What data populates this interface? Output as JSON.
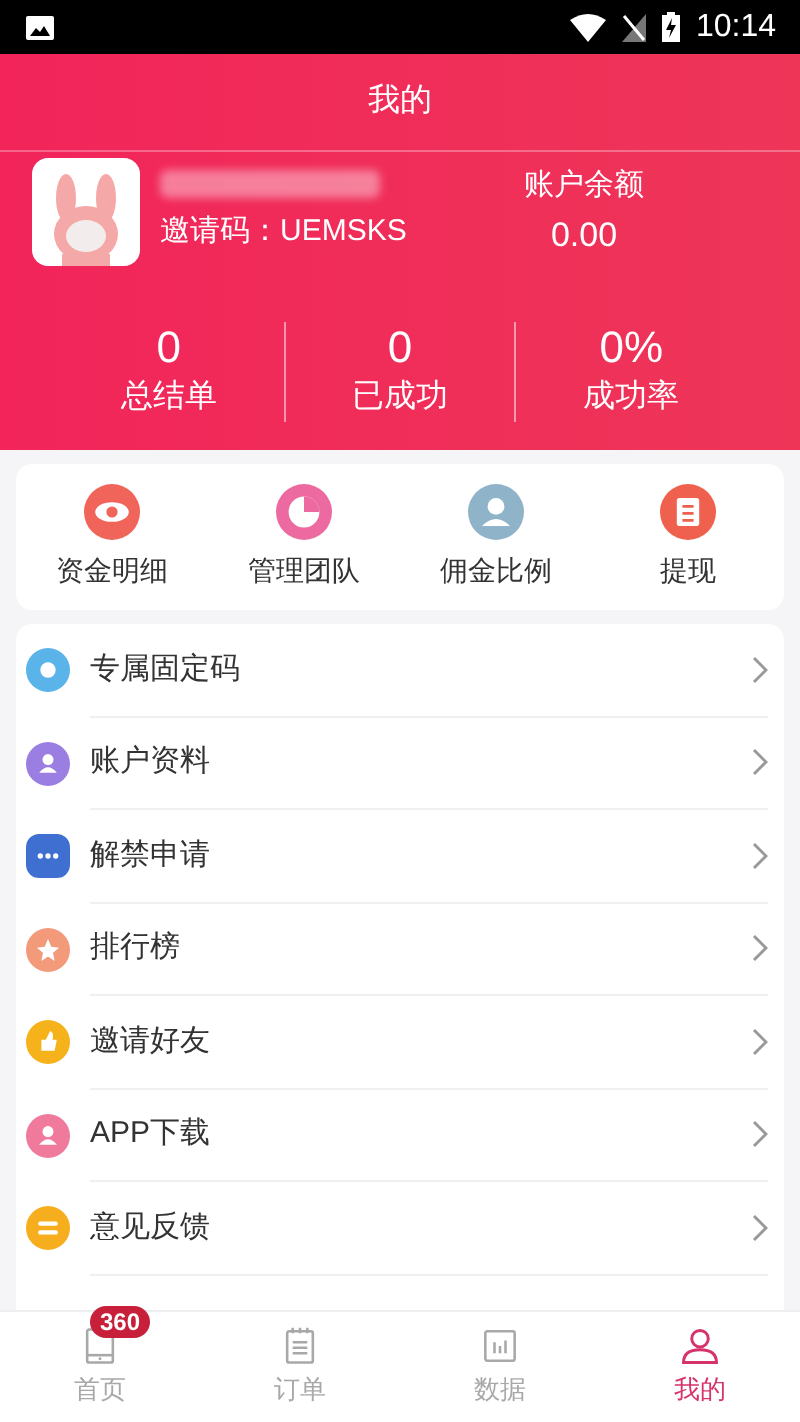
{
  "status_bar": {
    "time": "10:14"
  },
  "header": {
    "title": "我的",
    "invite_code": "邀请码：UEMSKS",
    "balance_label": "账户余额",
    "balance": "0.00"
  },
  "stats": [
    {
      "value": "0",
      "label": "总结单"
    },
    {
      "value": "0",
      "label": "已成功"
    },
    {
      "value": "0%",
      "label": "成功率"
    }
  ],
  "quick_actions": [
    {
      "label": "资金明细",
      "color": "#f0645a"
    },
    {
      "label": "管理团队",
      "color": "#ec6aa0"
    },
    {
      "label": "佣金比例",
      "color": "#8fb3c8"
    },
    {
      "label": "提现",
      "color": "#f0604e"
    }
  ],
  "menu": [
    {
      "label": "专属固定码",
      "color": "#5ab4ea"
    },
    {
      "label": "账户资料",
      "color": "#9a7ee2"
    },
    {
      "label": "解禁申请",
      "color": "#3f6fd0"
    },
    {
      "label": "排行榜",
      "color": "#f29a7a"
    },
    {
      "label": "邀请好友",
      "color": "#f6b21a"
    },
    {
      "label": "APP下载",
      "color": "#f07a9c"
    },
    {
      "label": "意见反馈",
      "color": "#f6ae1e"
    }
  ],
  "tab_bar": [
    {
      "label": "首页",
      "selected": false,
      "badge": "360"
    },
    {
      "label": "订单",
      "selected": false
    },
    {
      "label": "数据",
      "selected": false
    },
    {
      "label": "我的",
      "selected": true
    }
  ]
}
